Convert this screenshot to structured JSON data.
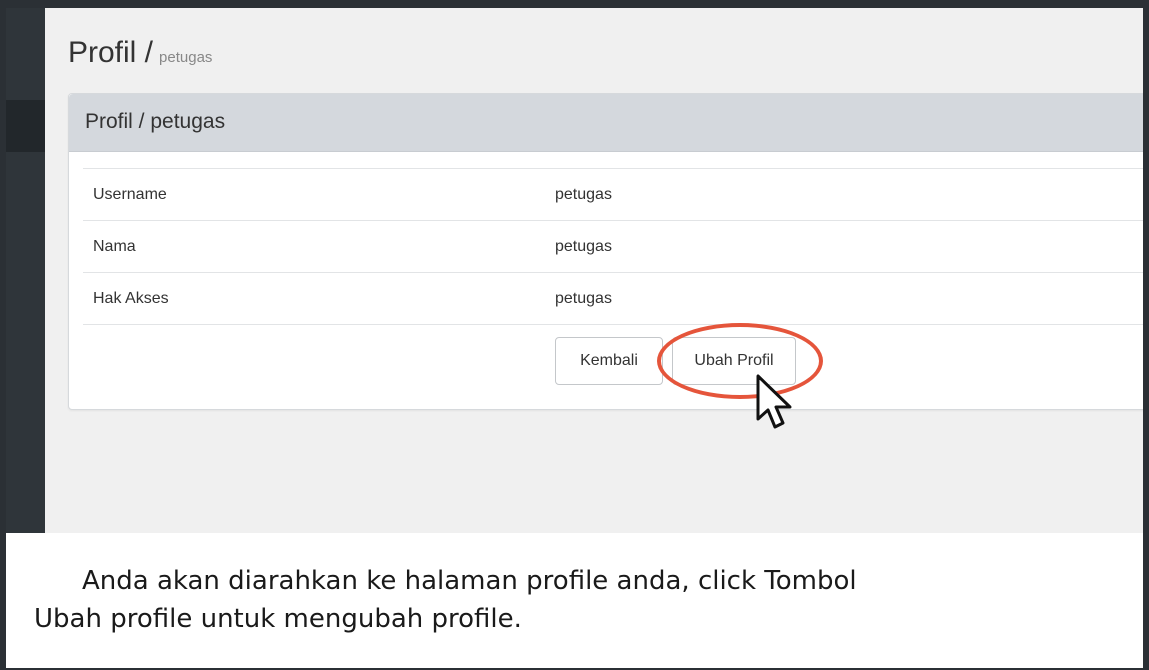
{
  "header": {
    "title": "Profil /",
    "subtitle": "petugas"
  },
  "panel": {
    "heading": "Profil / petugas",
    "rows": [
      {
        "label": "Username",
        "value": "petugas"
      },
      {
        "label": "Nama",
        "value": "petugas"
      },
      {
        "label": "Hak Akses",
        "value": "petugas"
      }
    ],
    "buttons": {
      "back_label": "Kembali",
      "edit_label": "Ubah Profil"
    }
  },
  "caption": {
    "line1": "Anda akan diarahkan ke halaman profile anda, click Tombol",
    "line2": "Ubah profile untuk mengubah profile."
  },
  "colors": {
    "highlight": "#e5553b",
    "sidebar": "#2f353a",
    "panel_heading": "#d4d8dd"
  },
  "icons": {
    "cursor": "mouse-pointer-icon"
  }
}
